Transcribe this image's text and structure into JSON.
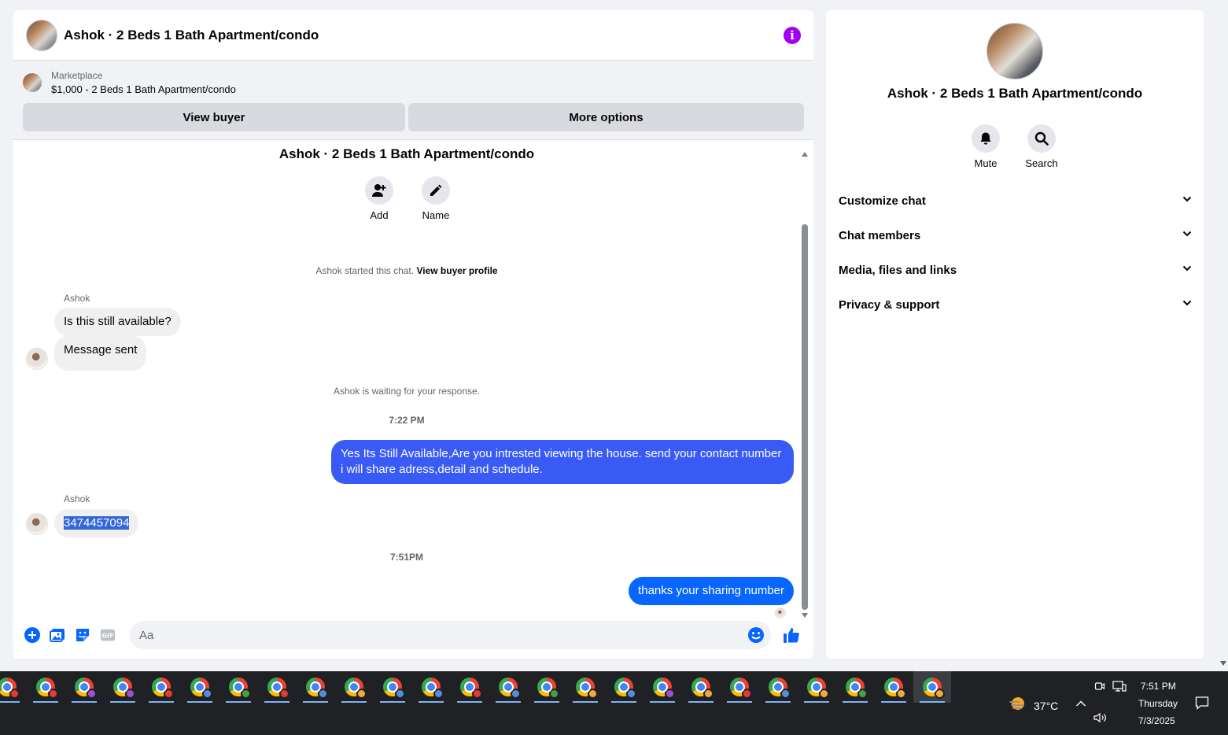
{
  "chat_header": {
    "title": "Ashok · 2 Beds 1 Bath Apartment/condo",
    "info_icon": "info-icon",
    "accent_color": "#a100f2"
  },
  "marketplace": {
    "label": "Marketplace",
    "listing": "$1,000 - 2 Beds 1 Bath Apartment/condo",
    "view_buyer": "View buyer",
    "more_options": "More options"
  },
  "conversation": {
    "title": "Ashok · 2 Beds 1 Bath Apartment/condo",
    "add_label": "Add",
    "name_label": "Name",
    "started_text": "Ashok started this chat.",
    "buyer_profile_link": "View buyer profile",
    "waiting_text": "Ashok is waiting for your response.",
    "messages": [
      {
        "sender": "Ashok",
        "text": "Is this still available?",
        "direction": "in"
      },
      {
        "text": "Message sent",
        "direction": "in"
      },
      {
        "time": "7:22 PM"
      },
      {
        "text": "Yes Its Still Available,Are you intrested viewing the house. send your contact number i will share adress,detail and schedule.",
        "direction": "out",
        "color": "#3a5af5"
      },
      {
        "sender": "Ashok",
        "text": "3474457094",
        "direction": "in",
        "selected": true
      },
      {
        "time": "7:51PM"
      },
      {
        "text": "thanks your sharing number",
        "direction": "out",
        "color": "#0866ff"
      }
    ]
  },
  "composer": {
    "placeholder": "Aa",
    "gif_label": "GIF",
    "accent_color": "#0866ff"
  },
  "info_panel": {
    "title": "Ashok · 2 Beds 1 Bath Apartment/condo",
    "mute_label": "Mute",
    "search_label": "Search",
    "sections": [
      "Customize chat",
      "Chat members",
      "Media, files and links",
      "Privacy & support"
    ]
  },
  "taskbar": {
    "weather": "37°C",
    "time": "7:51 PM",
    "day": "Thursday",
    "date": "7/3/2025",
    "chrome_window_count": 25,
    "profile_colors": [
      "#e53935",
      "#e53935",
      "#9c4fd6",
      "#9c4fd6",
      "#e53935",
      "#4f8fe0",
      "#43a047",
      "#e53935",
      "#4f8fe0",
      "#f2a93b",
      "#4f8fe0",
      "#4f8fe0",
      "#e53935",
      "#4f8fe0",
      "#43a047",
      "#f2a93b",
      "#4f8fe0",
      "#9c4fd6",
      "#f2a93b",
      "#e53935",
      "#4f8fe0",
      "#f2a93b",
      "#43a047",
      "#f2a93b",
      "#f2a93b"
    ]
  }
}
